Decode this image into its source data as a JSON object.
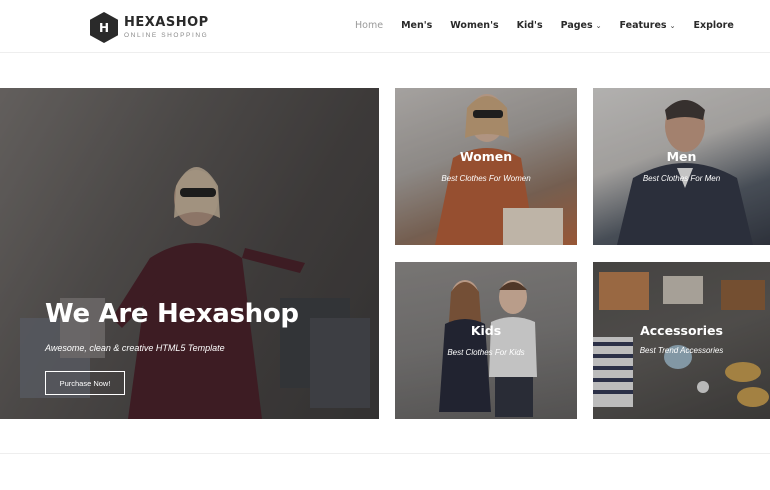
{
  "brand": {
    "name": "HEXASHOP",
    "tagline": "ONLINE SHOPPING",
    "logo_letter": "H"
  },
  "nav": {
    "items": [
      {
        "label": "Home",
        "active": true
      },
      {
        "label": "Men's"
      },
      {
        "label": "Women's"
      },
      {
        "label": "Kid's"
      },
      {
        "label": "Pages",
        "dropdown": true
      },
      {
        "label": "Features",
        "dropdown": true
      },
      {
        "label": "Explore"
      }
    ],
    "dropdown_icon": "chevron-down-icon"
  },
  "hero": {
    "title": "We Are Hexashop",
    "subtitle": "Awesome, clean & creative HTML5 Template",
    "button_label": "Purchase Now!"
  },
  "categories": [
    {
      "title": "Women",
      "subtitle": "Best Clothes For Women"
    },
    {
      "title": "Men",
      "subtitle": "Best Clothes For Men"
    },
    {
      "title": "Kids",
      "subtitle": "Best Clothes For Kids"
    },
    {
      "title": "Accessories",
      "subtitle": "Best Trend Accessories"
    }
  ],
  "colors": {
    "text_dark": "#2a2a2a",
    "nav_active": "#9a9a9a",
    "overlay_text": "#ffffff"
  }
}
